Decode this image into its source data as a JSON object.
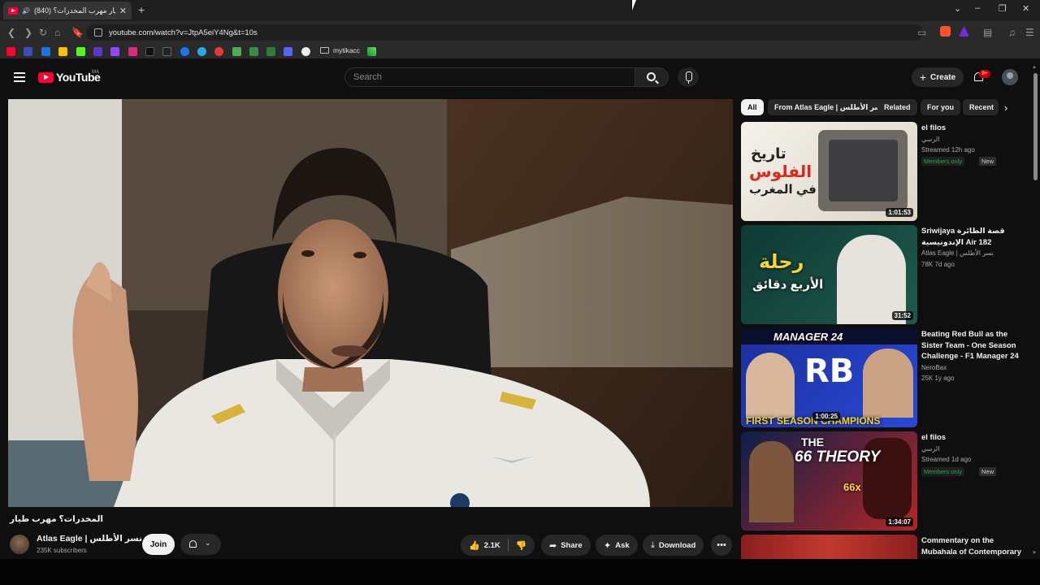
{
  "browser": {
    "tab_title": "(840) طيار مهرب المخدرات؟ - ...",
    "new_tab": "+",
    "url": "youtube.com/watch?v=JtpA5eiY4Ng&t=10s",
    "bookmark_folder": "mytikacc"
  },
  "header": {
    "logo_text": "YouTube",
    "country_code": "MA",
    "search_placeholder": "Search",
    "create_label": "Create",
    "notif_badge": "9+"
  },
  "video": {
    "title": "المخدرات؟ مهرب طيار",
    "channel_name": "Atlas Eagle | نسر الأطلس",
    "subscribers": "235K subscribers",
    "join_label": "Join",
    "likes": "2.1K",
    "share_label": "Share",
    "ask_label": "Ask",
    "download_label": "Download"
  },
  "chips": [
    "All",
    "From Atlas Eagle | نسر الأطلس",
    "Related",
    "For you",
    "Recent"
  ],
  "recommendations": [
    {
      "title": "el filos",
      "channel": "الرسي",
      "meta": "Streamed 12h ago",
      "members_only": "Members only",
      "new": "New",
      "duration": "1:01:53",
      "thumb_text_1": "تاريخ",
      "thumb_text_2": "الفلوس",
      "thumb_text_3": "في المغرب"
    },
    {
      "title": "Sriwijaya قصة الطائرة الإندونيسية Air 182",
      "channel": "Atlas Eagle | نسر الأطلس",
      "meta": "78K  7d ago",
      "duration": "31:52",
      "thumb_text_1": "رحلة",
      "thumb_text_2": "الأربع دقائق"
    },
    {
      "title": "Beating Red Bull as the Sister Team - One Season Challenge - F1 Manager 24",
      "channel": "NeroBax",
      "meta": "25K  1y ago",
      "duration": "1:00:25",
      "thumb_text_1": "MANAGER 24",
      "thumb_text_2": "FIRST SEASON CHAMPIONS"
    },
    {
      "title": "el filos",
      "channel": "الرسي",
      "meta": "Streamed 1d ago",
      "members_only": "Members only",
      "new": "New",
      "duration": "1:34:07",
      "thumb_text_1": "THE",
      "thumb_text_2": "66 THEORY",
      "thumb_text_3": "66x"
    },
    {
      "title": "Commentary on the Mubahala of Contemporary"
    }
  ]
}
